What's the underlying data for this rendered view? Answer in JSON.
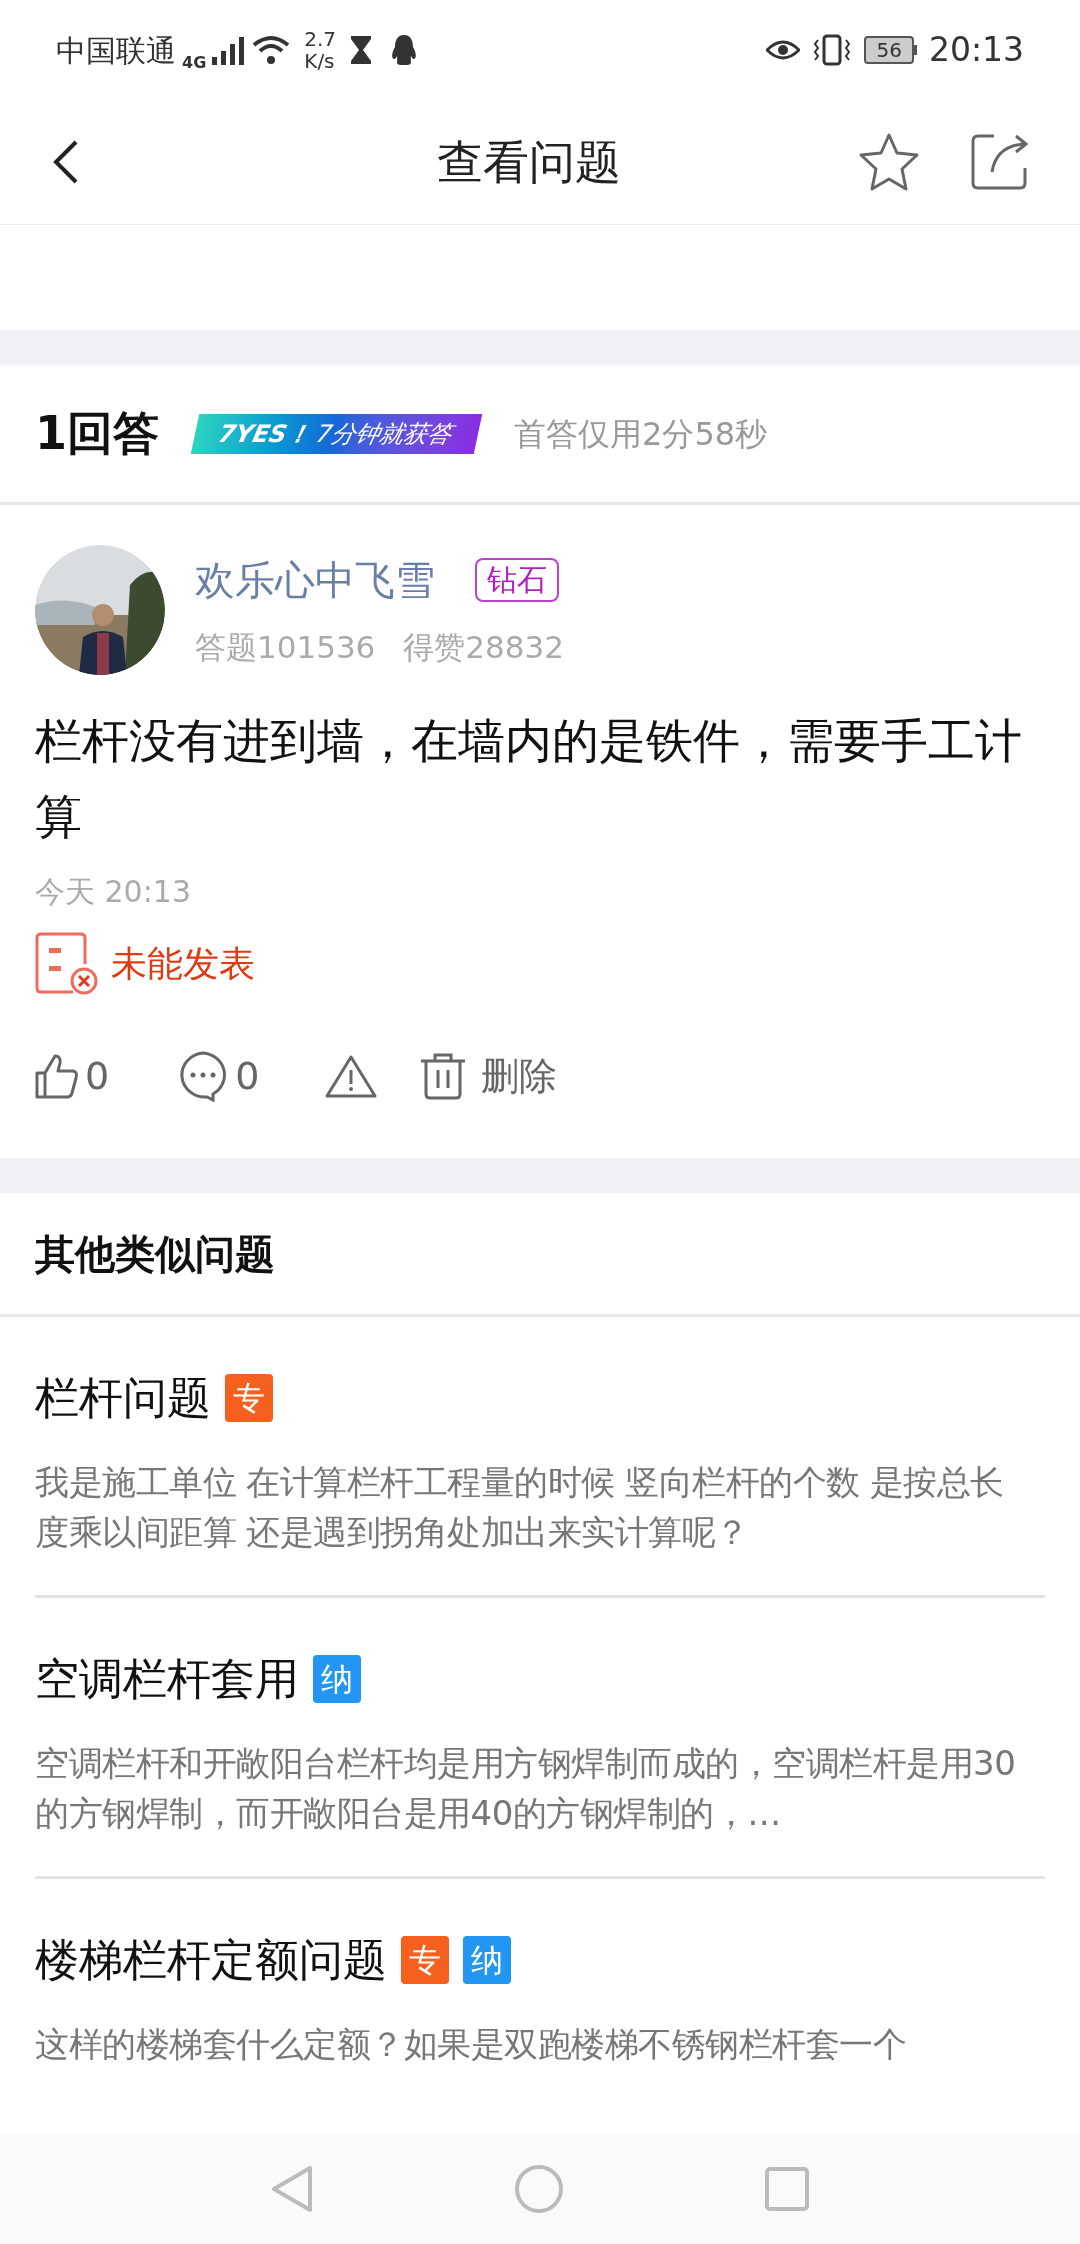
{
  "status_bar": {
    "carrier": "中国联通",
    "network": "4G",
    "speed_value": "2.7",
    "speed_unit": "K/s",
    "battery": "56",
    "time": "20:13"
  },
  "header": {
    "title": "查看问题"
  },
  "answers": {
    "count_label": "1回答",
    "badge_left": "7YES！",
    "badge_right": "7分钟就获答",
    "first_answer_note": "首答仅用2分58秒"
  },
  "answer": {
    "user": "欢乐心中飞雪",
    "level": "钻石",
    "answered": "答题101536",
    "likes_total": "得赞28832",
    "text": "栏杆没有进到墙，在墙内的是铁件，需要手工计算",
    "time": "今天 20:13",
    "failed": true,
    "failed_label": "未能发表",
    "likes": "0",
    "comments": "0",
    "delete_label": "删除"
  },
  "similar": {
    "title": "其他类似问题",
    "items": [
      {
        "title": "栏杆问题",
        "tags": [
          {
            "label": "专",
            "color": "#f5601f"
          }
        ],
        "description": "我是施工单位 在计算栏杆工程量的时候 竖向栏杆的个数 是按总长度乘以间距算 还是遇到拐角处加出来实计算呢？"
      },
      {
        "title": "空调栏杆套用",
        "tags": [
          {
            "label": "纳",
            "color": "#2196f3"
          }
        ],
        "description": "空调栏杆和开敞阳台栏杆均是用方钢焊制而成的，空调栏杆是用30的方钢焊制，而开敞阳台是用40的方钢焊制的，…"
      },
      {
        "title": "楼梯栏杆定额问题",
        "tags": [
          {
            "label": "专",
            "color": "#f5601f"
          },
          {
            "label": "纳",
            "color": "#2196f3"
          }
        ],
        "description": "这样的楼梯套什么定额？如果是双跑楼梯不锈钢栏杆套一个"
      }
    ]
  }
}
